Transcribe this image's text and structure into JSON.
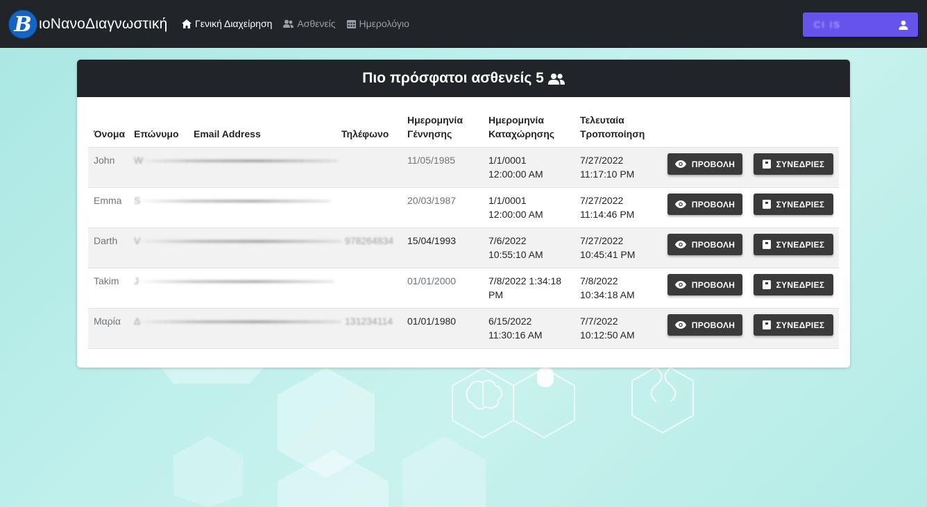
{
  "brand": {
    "logo_letter": "B",
    "name": "ιοΝανοΔιαγνωστική"
  },
  "nav": [
    {
      "label": "Γενική Διαχείρηση",
      "icon": "home-icon",
      "active": true
    },
    {
      "label": "Ασθενείς",
      "icon": "users-icon",
      "active": false
    },
    {
      "label": "Ημερολόγιο",
      "icon": "calendar-icon",
      "active": false
    }
  ],
  "user_button": {
    "label": "CI IS",
    "icon": "person-icon",
    "color": "#6653ec"
  },
  "card": {
    "title": "Πιο πρόσφατοι ασθενείς 5",
    "title_icon": "people-icon"
  },
  "table": {
    "headers": {
      "name": "Όνομα",
      "surname": "Επώνυμο",
      "email": "Email Address",
      "phone": "Τηλέφωνο",
      "birth_1": "Ημερομηνία",
      "birth_2": "Γέννησης",
      "reg_1": "Ημερομηνία",
      "reg_2": "Καταχώρησης",
      "mod_1": "Τελευταία",
      "mod_2": "Τροποποίηση"
    },
    "rows": [
      {
        "name": "John",
        "surname": "W",
        "phone": "",
        "birth": "11/05/1985",
        "reg_1": "1/1/0001",
        "reg_2": "12:00:00 AM",
        "mod_1": "7/27/2022",
        "mod_2": "11:17:10 PM"
      },
      {
        "name": "Emma",
        "surname": "S",
        "phone": "",
        "birth": "20/03/1987",
        "reg_1": "1/1/0001",
        "reg_2": "12:00:00 AM",
        "mod_1": "7/27/2022",
        "mod_2": "11:14:46 PM"
      },
      {
        "name": "Darth",
        "surname": "V",
        "phone": "978264834",
        "birth": "15/04/1993",
        "reg_1": "7/6/2022",
        "reg_2": "10:55:10 AM",
        "mod_1": "7/27/2022",
        "mod_2": "10:45:41 PM"
      },
      {
        "name": "Takim",
        "surname": "J",
        "phone": "",
        "birth": "01/01/2000",
        "reg_1": "7/8/2022 1:34:18",
        "reg_2": "PM",
        "mod_1": "7/8/2022",
        "mod_2": "10:34:18 AM"
      },
      {
        "name": "Μαρία",
        "surname": "Δ",
        "phone": "131234114",
        "birth": "01/01/1980",
        "reg_1": "6/15/2022",
        "reg_2": "11:30:16 AM",
        "mod_1": "7/7/2022",
        "mod_2": "10:12:50 AM"
      }
    ],
    "view_label": "ΠΡΟΒΟΛΗ",
    "sessions_label": "ΣΥΝΕΔΡΙΕΣ",
    "view_icon": "eye-icon",
    "sessions_icon": "clipboard-icon"
  },
  "colors": {
    "navbar": "#212529",
    "button": "#3a3a3a",
    "background": "#bff0ec"
  }
}
